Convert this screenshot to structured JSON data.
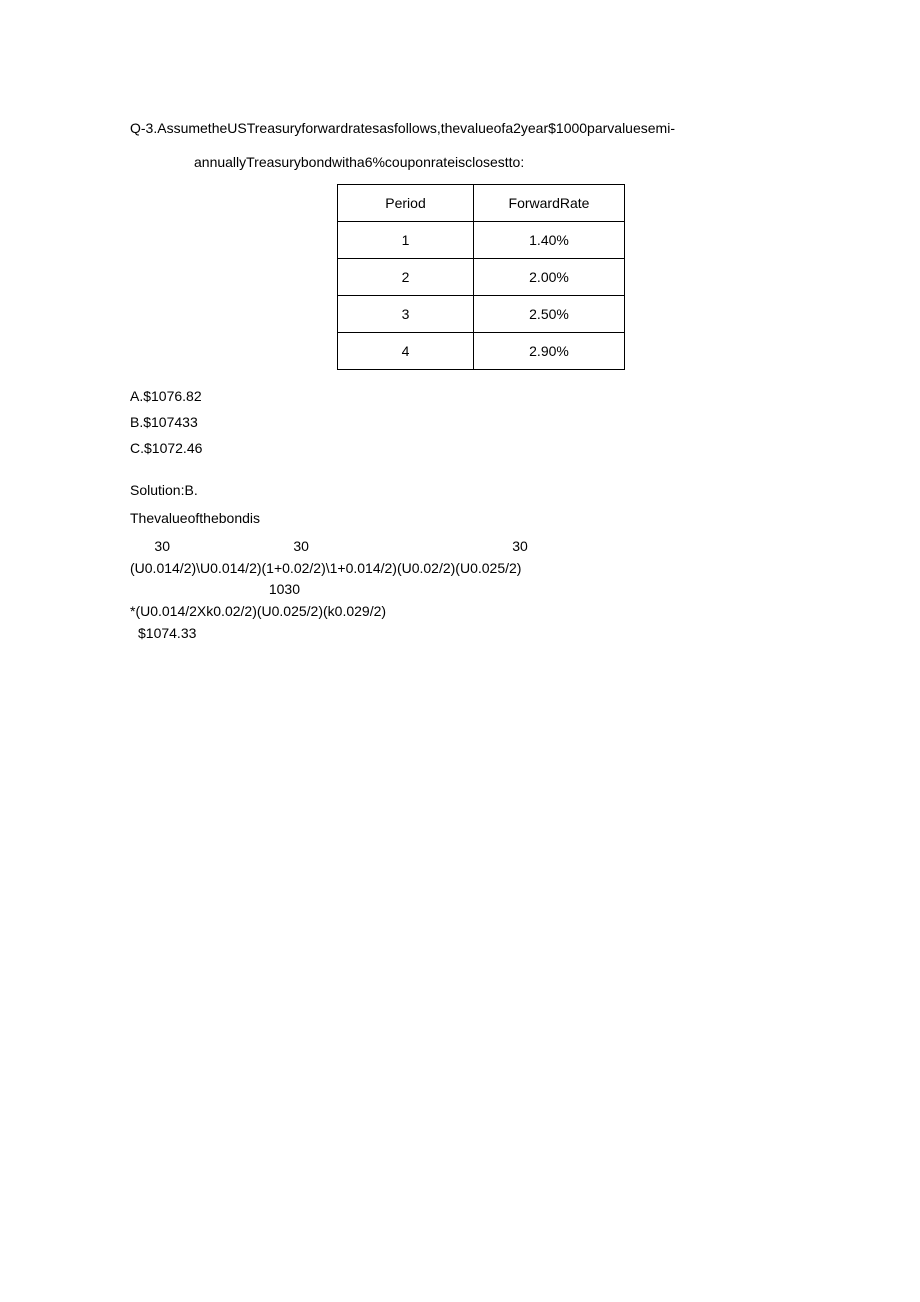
{
  "question": {
    "number": "Q-3.",
    "line1_rest": "AssumetheUSTreasuryforwardratesasfollows,thevalueofa2year$1000parvaluesemi-",
    "line2": "annuallyTreasurybondwitha6%couponrateisclosestto:"
  },
  "table": {
    "headers": {
      "col1": "Period",
      "col2": "ForwardRate"
    },
    "rows": [
      {
        "period": "1",
        "rate": "1.40%"
      },
      {
        "period": "2",
        "rate": "2.00%"
      },
      {
        "period": "3",
        "rate": "2.50%"
      },
      {
        "period": "4",
        "rate": "2.90%"
      }
    ]
  },
  "answers": {
    "a": "A.$1076.82",
    "b": "B.$107433",
    "c": "C.$1072.46"
  },
  "solution": {
    "label": "Solution:B.",
    "intro_pre": "Thevalue",
    "intro_bold": "of",
    "intro_post": "thebondis",
    "num_row1_a": "30",
    "num_row1_b": "30",
    "num_row1_c": "30",
    "den_row1": "(U0.014/2)\\U0.014/2)(1+0.02/2)\\1+0.014/2)(U0.02/2)(U0.025/2)",
    "num_row2": "1030",
    "den_row2": "*(U0.014/2Xk0.02/2)(U0.025/2)(k0.029/2)",
    "result": "$1074.33"
  },
  "chart_data": {
    "type": "table",
    "title": "Forward Rates",
    "columns": [
      "Period",
      "ForwardRate"
    ],
    "rows": [
      [
        "1",
        "1.40%"
      ],
      [
        "2",
        "2.00%"
      ],
      [
        "3",
        "2.50%"
      ],
      [
        "4",
        "2.90%"
      ]
    ]
  }
}
